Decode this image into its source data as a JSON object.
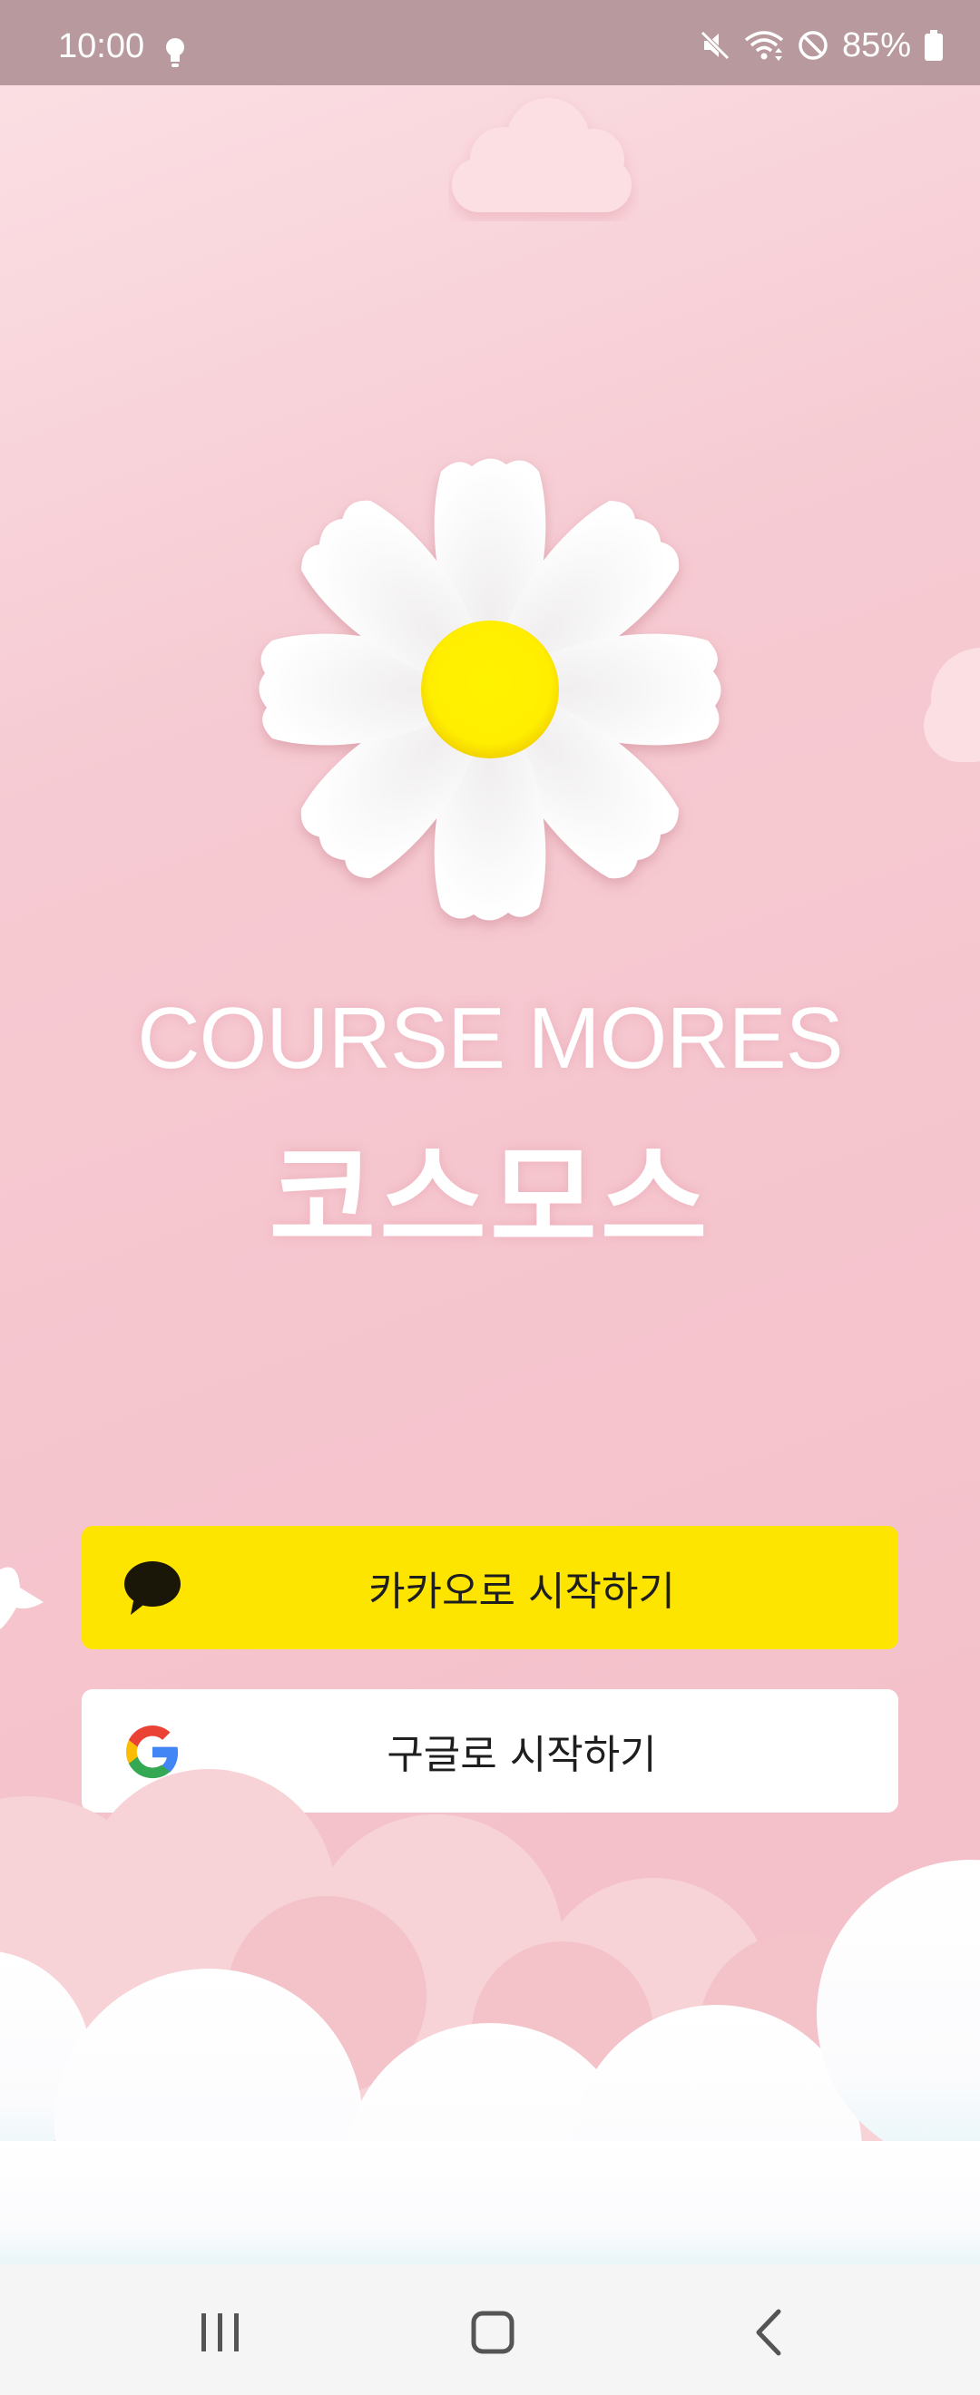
{
  "status_bar": {
    "time": "10:00",
    "battery": "85%",
    "icons": [
      "bulb-icon",
      "mute-icon",
      "wifi-icon",
      "do-not-disturb-icon",
      "battery-icon"
    ]
  },
  "hero": {
    "title_en": "COURSE MORES",
    "title_ko": "코스모스"
  },
  "login": {
    "kakao_label": "카카오로 시작하기",
    "google_label": "구글로 시작하기",
    "kakao_color": "#fee500",
    "google_color": "#ffffff"
  },
  "nav_bar": {
    "buttons": [
      "recents-icon",
      "home-icon",
      "back-icon"
    ]
  },
  "colors": {
    "background": "#f5c4cd",
    "status_bar": "#b8999e",
    "flower_center": "#fff200"
  }
}
